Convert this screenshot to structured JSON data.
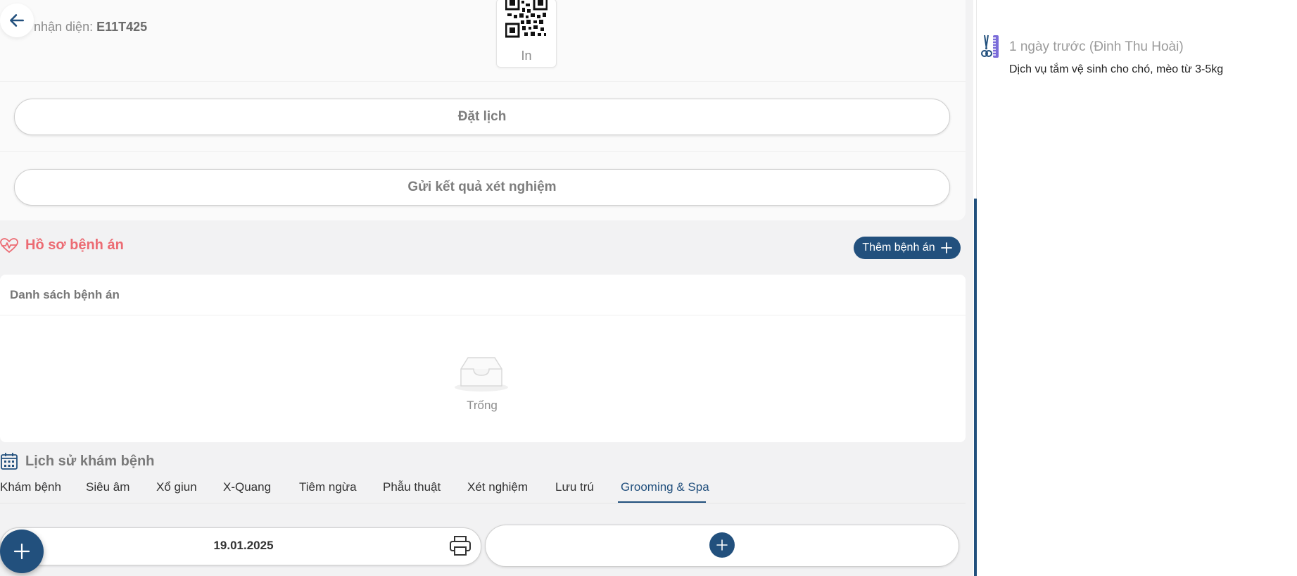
{
  "header": {
    "id_label": "nhận diện:",
    "id_value": "E11T425",
    "qr_print_label": "In"
  },
  "actions": {
    "schedule_label": "Đặt lịch",
    "send_results_label": "Gửi kết quả xét nghiệm"
  },
  "records": {
    "title": "Hồ sơ bệnh án",
    "add_label": "Thêm bệnh án",
    "list_header": "Danh sách bệnh án",
    "empty_text": "Trống"
  },
  "history": {
    "title": "Lịch sử khám bệnh",
    "tabs": [
      {
        "label": "Khám bệnh"
      },
      {
        "label": "Siêu âm"
      },
      {
        "label": "Xổ giun"
      },
      {
        "label": "X-Quang"
      },
      {
        "label": "Tiêm ngừa"
      },
      {
        "label": "Phẫu thuật"
      },
      {
        "label": "Xét nghiệm"
      },
      {
        "label": "Lưu trú"
      },
      {
        "label": "Grooming & Spa"
      }
    ],
    "active_tab": "Grooming & Spa",
    "entry_date": "19.01.2025"
  },
  "timeline": {
    "time_text": "1 ngày trước (Đinh Thu Hoài)",
    "description": "Dịch vụ tắm vệ sinh cho chó, mèo từ 3-5kg",
    "icon": "grooming-scissors-comb-icon"
  },
  "colors": {
    "primary": "#22507d",
    "records_accent": "#ec6b73",
    "page_bg": "#f2f2f3"
  }
}
